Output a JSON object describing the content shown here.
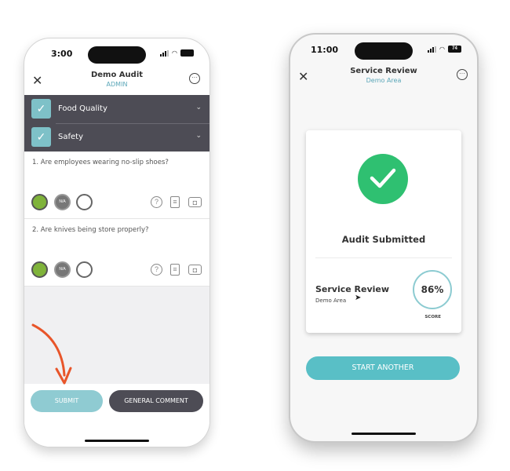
{
  "left_phone": {
    "status_time": "3:00",
    "header": {
      "title": "Demo Audit",
      "subtitle": "ADMIN"
    },
    "sections": [
      {
        "label": "Food Quality",
        "checked": true
      },
      {
        "label": "Safety",
        "checked": true
      }
    ],
    "questions": [
      {
        "text": "1. Are employees wearing no-slip shoes?",
        "na_label": "N/A"
      },
      {
        "text": "2. Are knives being store properly?",
        "na_label": "N/A"
      }
    ],
    "tools": {
      "help": "?",
      "note": "≡",
      "camera": "◘"
    },
    "buttons": {
      "submit": "SUBMIT",
      "general_comment": "GENERAL COMMENT"
    },
    "colors": {
      "section_bg": "#4d4c55",
      "check": "#7ec1c8",
      "yes": "#7fb33a",
      "submit": "#8fcbd2",
      "arrow": "#e8552a"
    }
  },
  "right_phone": {
    "status_time": "11:00",
    "battery": "74",
    "header": {
      "title": "Service Review",
      "subtitle": "Demo Area"
    },
    "card": {
      "headline": "Audit Submitted",
      "audit_name": "Service Review",
      "area": "Demo Area",
      "score": "86%",
      "score_label": "SCORE"
    },
    "buttons": {
      "start_another": "START ANOTHER"
    },
    "colors": {
      "success": "#2fc071",
      "ring": "#8ccbd1",
      "start_button": "#59bfc6"
    }
  }
}
